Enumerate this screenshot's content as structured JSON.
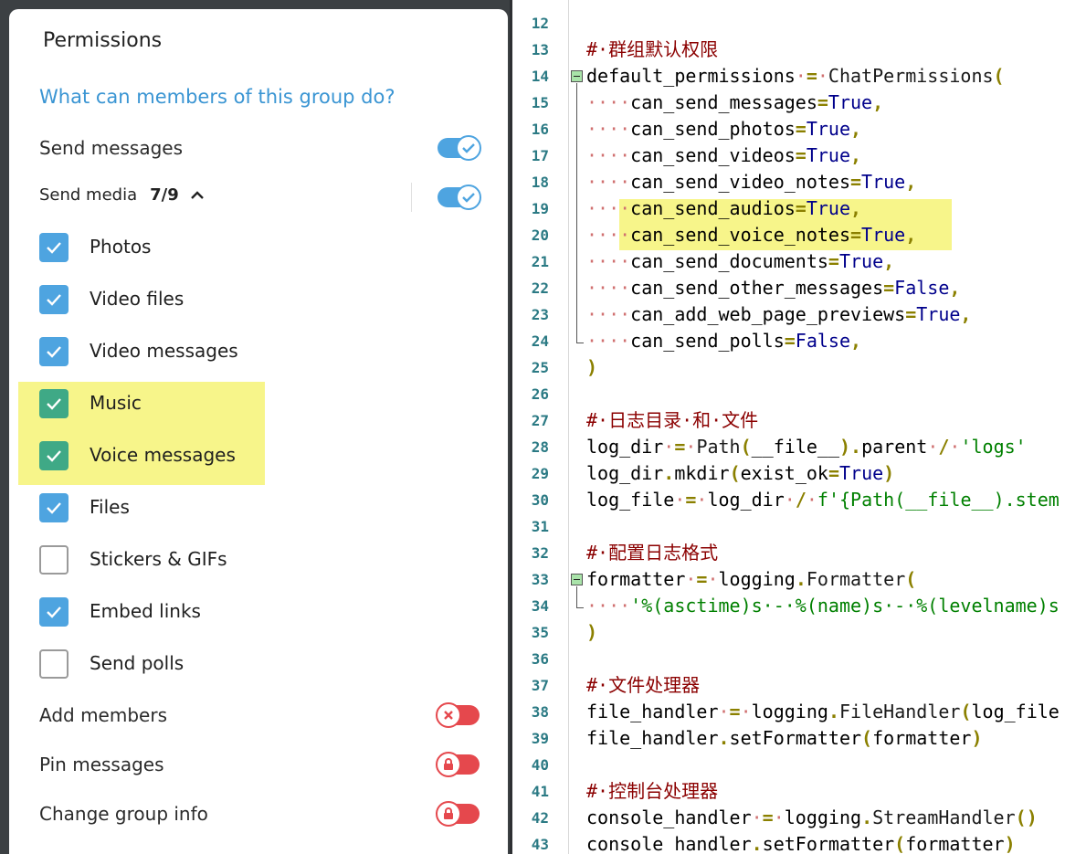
{
  "dialog": {
    "title": "Permissions",
    "subtitle": "What can members of this group do?",
    "send_messages": {
      "label": "Send messages",
      "enabled": true
    },
    "send_media": {
      "label": "Send media",
      "count": "7/9",
      "enabled": true
    },
    "media_items": [
      {
        "label": "Photos",
        "checked": true,
        "highlighted": false
      },
      {
        "label": "Video files",
        "checked": true,
        "highlighted": false
      },
      {
        "label": "Video messages",
        "checked": true,
        "highlighted": false
      },
      {
        "label": "Music",
        "checked": true,
        "highlighted": true
      },
      {
        "label": "Voice messages",
        "checked": true,
        "highlighted": true
      },
      {
        "label": "Files",
        "checked": true,
        "highlighted": false
      },
      {
        "label": "Stickers & GIFs",
        "checked": false,
        "highlighted": false
      },
      {
        "label": "Embed links",
        "checked": true,
        "highlighted": false
      },
      {
        "label": "Send polls",
        "checked": false,
        "highlighted": false
      }
    ],
    "bottom_toggles": [
      {
        "label": "Add members",
        "enabled": false,
        "icon": "x-icon"
      },
      {
        "label": "Pin messages",
        "enabled": false,
        "icon": "lock-icon"
      },
      {
        "label": "Change group info",
        "enabled": false,
        "icon": "lock-icon"
      }
    ]
  },
  "editor": {
    "highlight_color": "#f7f58a",
    "lines": [
      {
        "n": "12",
        "tokens": []
      },
      {
        "n": "13",
        "tokens": [
          [
            "c-com",
            "#·群组默认权限"
          ]
        ]
      },
      {
        "n": "14",
        "fold": "start",
        "tokens": [
          [
            "c-id",
            "default_permissions"
          ],
          [
            "c-dot",
            "·"
          ],
          [
            "c-op",
            "="
          ],
          [
            "c-dot",
            "·"
          ],
          [
            "c-cls",
            "ChatPermissions"
          ],
          [
            "c-op",
            "("
          ]
        ]
      },
      {
        "n": "15",
        "tokens": [
          [
            "c-dot",
            "····"
          ],
          [
            "c-id",
            "can_send_messages"
          ],
          [
            "c-op",
            "="
          ],
          [
            "c-kw",
            "True"
          ],
          [
            "c-op",
            ","
          ]
        ]
      },
      {
        "n": "16",
        "tokens": [
          [
            "c-dot",
            "····"
          ],
          [
            "c-id",
            "can_send_photos"
          ],
          [
            "c-op",
            "="
          ],
          [
            "c-kw",
            "True"
          ],
          [
            "c-op",
            ","
          ]
        ]
      },
      {
        "n": "17",
        "tokens": [
          [
            "c-dot",
            "····"
          ],
          [
            "c-id",
            "can_send_videos"
          ],
          [
            "c-op",
            "="
          ],
          [
            "c-kw",
            "True"
          ],
          [
            "c-op",
            ","
          ]
        ]
      },
      {
        "n": "18",
        "tokens": [
          [
            "c-dot",
            "····"
          ],
          [
            "c-id",
            "can_send_video_notes"
          ],
          [
            "c-op",
            "="
          ],
          [
            "c-kw",
            "True"
          ],
          [
            "c-op",
            ","
          ]
        ]
      },
      {
        "n": "19",
        "tokens": [
          [
            "c-dot",
            "····"
          ],
          [
            "c-id",
            "can_send_audios"
          ],
          [
            "c-op",
            "="
          ],
          [
            "c-kw",
            "True"
          ],
          [
            "c-op",
            ","
          ]
        ]
      },
      {
        "n": "20",
        "tokens": [
          [
            "c-dot",
            "····"
          ],
          [
            "c-id",
            "can_send_voice_notes"
          ],
          [
            "c-op",
            "="
          ],
          [
            "c-kw",
            "True"
          ],
          [
            "c-op",
            ","
          ]
        ]
      },
      {
        "n": "21",
        "tokens": [
          [
            "c-dot",
            "····"
          ],
          [
            "c-id",
            "can_send_documents"
          ],
          [
            "c-op",
            "="
          ],
          [
            "c-kw",
            "True"
          ],
          [
            "c-op",
            ","
          ]
        ]
      },
      {
        "n": "22",
        "tokens": [
          [
            "c-dot",
            "····"
          ],
          [
            "c-id",
            "can_send_other_messages"
          ],
          [
            "c-op",
            "="
          ],
          [
            "c-kw",
            "False"
          ],
          [
            "c-op",
            ","
          ]
        ]
      },
      {
        "n": "23",
        "tokens": [
          [
            "c-dot",
            "····"
          ],
          [
            "c-id",
            "can_add_web_page_previews"
          ],
          [
            "c-op",
            "="
          ],
          [
            "c-kw",
            "True"
          ],
          [
            "c-op",
            ","
          ]
        ]
      },
      {
        "n": "24",
        "fold": "end",
        "tokens": [
          [
            "c-dot",
            "····"
          ],
          [
            "c-id",
            "can_send_polls"
          ],
          [
            "c-op",
            "="
          ],
          [
            "c-kw",
            "False"
          ],
          [
            "c-op",
            ","
          ]
        ]
      },
      {
        "n": "25",
        "tokens": [
          [
            "c-op",
            ")"
          ]
        ]
      },
      {
        "n": "26",
        "tokens": []
      },
      {
        "n": "27",
        "tokens": [
          [
            "c-com",
            "#·日志目录·和·文件"
          ]
        ]
      },
      {
        "n": "28",
        "tokens": [
          [
            "c-id",
            "log_dir"
          ],
          [
            "c-dot",
            "·"
          ],
          [
            "c-op",
            "="
          ],
          [
            "c-dot",
            "·"
          ],
          [
            "c-cls",
            "Path"
          ],
          [
            "c-op",
            "("
          ],
          [
            "c-id",
            "__file__"
          ],
          [
            "c-op",
            ")."
          ],
          [
            "c-id",
            "parent"
          ],
          [
            "c-dot",
            "·"
          ],
          [
            "c-op",
            "/"
          ],
          [
            "c-dot",
            "·"
          ],
          [
            "c-str",
            "'logs'"
          ]
        ]
      },
      {
        "n": "29",
        "tokens": [
          [
            "c-id",
            "log_dir"
          ],
          [
            "c-op",
            "."
          ],
          [
            "c-id",
            "mkdir"
          ],
          [
            "c-op",
            "("
          ],
          [
            "c-id",
            "exist_ok"
          ],
          [
            "c-op",
            "="
          ],
          [
            "c-kw",
            "True"
          ],
          [
            "c-op",
            ")"
          ]
        ]
      },
      {
        "n": "30",
        "tokens": [
          [
            "c-id",
            "log_file"
          ],
          [
            "c-dot",
            "·"
          ],
          [
            "c-op",
            "="
          ],
          [
            "c-dot",
            "·"
          ],
          [
            "c-id",
            "log_dir"
          ],
          [
            "c-dot",
            "·"
          ],
          [
            "c-op",
            "/"
          ],
          [
            "c-dot",
            "·"
          ],
          [
            "c-str",
            "f'{Path(__file__).stem"
          ]
        ]
      },
      {
        "n": "31",
        "tokens": []
      },
      {
        "n": "32",
        "tokens": [
          [
            "c-com",
            "#·配置日志格式"
          ]
        ]
      },
      {
        "n": "33",
        "fold": "start",
        "tokens": [
          [
            "c-id",
            "formatter"
          ],
          [
            "c-dot",
            "·"
          ],
          [
            "c-op",
            "="
          ],
          [
            "c-dot",
            "·"
          ],
          [
            "c-id",
            "logging"
          ],
          [
            "c-op",
            "."
          ],
          [
            "c-cls",
            "Formatter"
          ],
          [
            "c-op",
            "("
          ]
        ]
      },
      {
        "n": "34",
        "fold": "end",
        "tokens": [
          [
            "c-dot",
            "····"
          ],
          [
            "c-str",
            "'%(asctime)s·-·%(name)s·-·%(levelname)s"
          ]
        ]
      },
      {
        "n": "35",
        "tokens": [
          [
            "c-op",
            ")"
          ]
        ]
      },
      {
        "n": "36",
        "tokens": []
      },
      {
        "n": "37",
        "tokens": [
          [
            "c-com",
            "#·文件处理器"
          ]
        ]
      },
      {
        "n": "38",
        "tokens": [
          [
            "c-id",
            "file_handler"
          ],
          [
            "c-dot",
            "·"
          ],
          [
            "c-op",
            "="
          ],
          [
            "c-dot",
            "·"
          ],
          [
            "c-id",
            "logging"
          ],
          [
            "c-op",
            "."
          ],
          [
            "c-cls",
            "FileHandler"
          ],
          [
            "c-op",
            "("
          ],
          [
            "c-id",
            "log_file"
          ]
        ]
      },
      {
        "n": "39",
        "tokens": [
          [
            "c-id",
            "file_handler"
          ],
          [
            "c-op",
            "."
          ],
          [
            "c-id",
            "setFormatter"
          ],
          [
            "c-op",
            "("
          ],
          [
            "c-id",
            "formatter"
          ],
          [
            "c-op",
            ")"
          ]
        ]
      },
      {
        "n": "40",
        "tokens": []
      },
      {
        "n": "41",
        "tokens": [
          [
            "c-com",
            "#·控制台处理器"
          ]
        ]
      },
      {
        "n": "42",
        "tokens": [
          [
            "c-id",
            "console_handler"
          ],
          [
            "c-dot",
            "·"
          ],
          [
            "c-op",
            "="
          ],
          [
            "c-dot",
            "·"
          ],
          [
            "c-id",
            "logging"
          ],
          [
            "c-op",
            "."
          ],
          [
            "c-cls",
            "StreamHandler"
          ],
          [
            "c-op",
            "()"
          ]
        ]
      },
      {
        "n": "43",
        "tokens": [
          [
            "c-id",
            "console_handler"
          ],
          [
            "c-op",
            "."
          ],
          [
            "c-id",
            "setFormatter"
          ],
          [
            "c-op",
            "("
          ],
          [
            "c-id",
            "formatter"
          ],
          [
            "c-op",
            ")"
          ]
        ]
      }
    ]
  }
}
